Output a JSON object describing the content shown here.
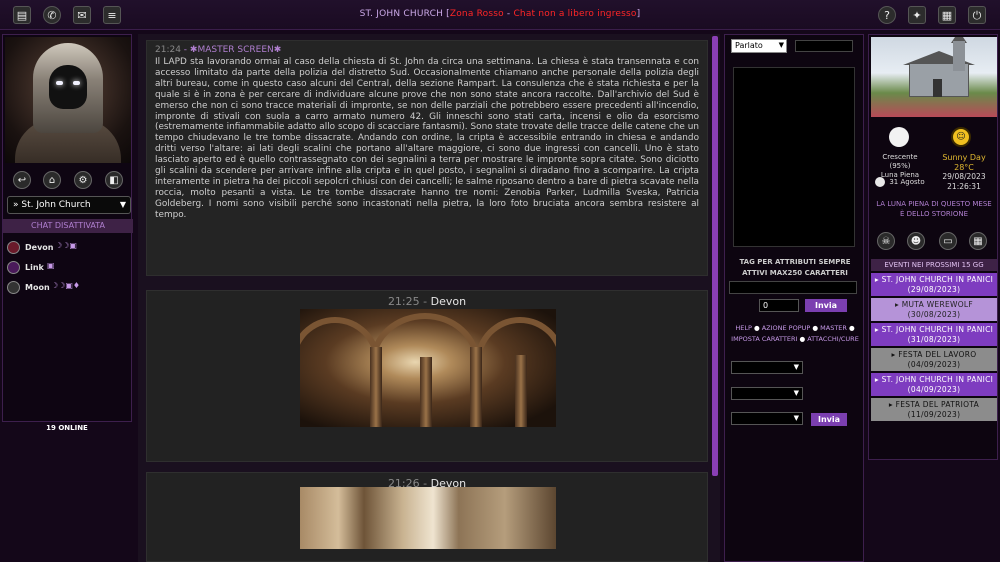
{
  "topbar": {
    "title_main": "ST. JOHN CHURCH ",
    "title_bracket_open": "[",
    "title_zone": "Zona Rosso",
    "title_sep": " - ",
    "title_status": "Chat non a libero ingresso",
    "title_bracket_close": "]",
    "left_icons": [
      "folder-icon",
      "whatsapp-icon",
      "mail-icon",
      "list-icon"
    ],
    "right_icons": [
      "help-icon",
      "puzzle-icon",
      "document-icon",
      "exit-icon"
    ]
  },
  "left_panel": {
    "icons": [
      "return-icon",
      "house-icon",
      "gear-icon",
      "bag-icon"
    ],
    "room_select": "» St. John Church",
    "chat_status": "CHAT DISATTIVATA",
    "users": [
      {
        "name": "Devon",
        "badges": "☽☽▣"
      },
      {
        "name": "Link",
        "badges": "▣"
      },
      {
        "name": "Moon",
        "badges": "☽☽▣♦"
      }
    ],
    "online": "19 ONLINE"
  },
  "main": {
    "master": {
      "time": "21:24",
      "label": " - ✱MASTER SCREEN✱",
      "text": "Il LAPD sta lavorando ormai al caso della chiesta di St. John da circa una settimana. La chiesa è stata transennata e con accesso limitato da parte della polizia del distretto Sud. Occasionalmente chiamano anche personale della polizia degli altri bureau, come in questo caso alcuni del Central, della sezione Rampart. La consulenza che è stata richiesta e per la quale si è in zona è per cercare di individuare alcune prove che non sono state ancora raccolte. Dall'archivio del Sud è emerso che non ci sono tracce materiali di impronte, se non delle parziali che potrebbero essere precedenti all'incendio, impronte di stivali con suola a carro armato numero 42. Gli inneschi sono stati carta, incensi e olio da esorcismo (estremamente infiammabile adatto allo scopo di scacciare fantasmi). Sono state trovate delle tracce delle catene che un tempo chiudevano le tre tombe dissacrate. Andando con ordine, la cripta è accessibile entrando in chiesa e andando dritti verso l'altare: ai lati degli scalini che portano all'altare maggiore, ci sono due ingressi con cancelli. Uno è stato lasciato aperto ed è quello contrassegnato con dei segnalini a terra per mostrare le impronte sopra citate. Sono diciotto gli scalini da scendere per arrivare infine alla cripta e in quel posto, i segnalini si diradano fino a scomparire. La cripta interamente in pietra ha dei piccoli sepolcri chiusi con dei cancelli; le salme riposano dentro a bare di pietra scavate nella roccia, molto pesanti a vista. Le tre tombe dissacrate hanno tre nomi: Zenobia Parker, Ludmilla Sveska, Patricia Goldeberg. I nomi sono visibili perché sono incastonati nella pietra, la loro foto bruciata ancora sembra resistere al tempo."
    },
    "messages": [
      {
        "time": "21:25",
        "sep": " - ",
        "who": "Devon"
      },
      {
        "time": "21:26",
        "sep": " - ",
        "who": "Devon"
      }
    ]
  },
  "chat_panel": {
    "mode_select": "Parlato",
    "tag_note": "TAG PER ATTRIBUTI SEMPRE ATTIVI MAX250 CARATTERI",
    "number_value": "0",
    "send_label": "Invia",
    "send_label_2": "Invia",
    "links": [
      "HELP",
      "AZIONE POPUP",
      "MASTER",
      "IMPOSTA CARATTERI",
      "ATTACCHI/CURE"
    ]
  },
  "right_panel": {
    "moon_phase": "Crescente",
    "moon_percent": "(95%)",
    "full_moon_label": "Luna Piena",
    "full_moon_date": "31 Agosto",
    "weather": "Sunny Day",
    "temperature": "28°C",
    "date": "29/08/2023",
    "time": "21:26:31",
    "moon_note": "LA LUNA PIENA DI QUESTO MESE È DELLO STORIONE",
    "icons": [
      "skull-icon",
      "masks-icon",
      "chat-icon",
      "calendar-icon"
    ],
    "events_title": "EVENTI NEI PROSSIMI 15 GG",
    "events": [
      {
        "name": "▸ ST. JOHN CHURCH IN PANICI",
        "date": "(29/08/2023)",
        "color": "#7e3cc0"
      },
      {
        "name": "▸ MUTA WEREWOLF",
        "date": "(30/08/2023)",
        "color": "#b593d8"
      },
      {
        "name": "▸ ST. JOHN CHURCH IN PANICI",
        "date": "(31/08/2023)",
        "color": "#7e3cc0"
      },
      {
        "name": "▸ FESTA DEL LAVORO",
        "date": "(04/09/2023)",
        "color": "#8c8c8c"
      },
      {
        "name": "▸ ST. JOHN CHURCH IN PANICI",
        "date": "(04/09/2023)",
        "color": "#7e3cc0"
      },
      {
        "name": "▸ FESTA DEL PATRIOTA",
        "date": "(11/09/2023)",
        "color": "#8c8c8c"
      }
    ]
  }
}
